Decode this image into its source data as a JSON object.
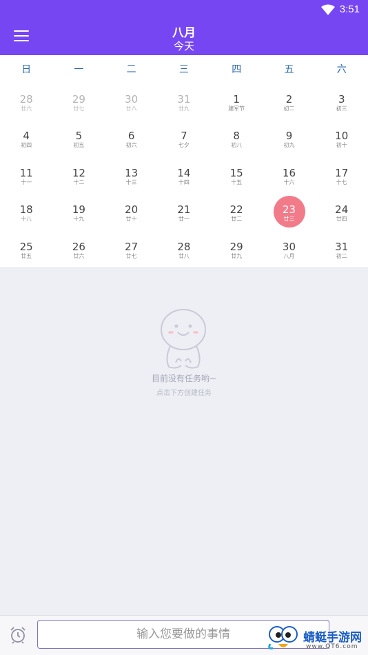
{
  "status": {
    "time": "3:51"
  },
  "header": {
    "month": "八月",
    "today_button": "今天"
  },
  "weekdays": [
    "日",
    "一",
    "二",
    "三",
    "四",
    "五",
    "六"
  ],
  "days": [
    {
      "num": "28",
      "sub": "廿六",
      "other": true
    },
    {
      "num": "29",
      "sub": "廿七",
      "other": true
    },
    {
      "num": "30",
      "sub": "廿八",
      "other": true
    },
    {
      "num": "31",
      "sub": "廿九",
      "other": true
    },
    {
      "num": "1",
      "sub": "建军节"
    },
    {
      "num": "2",
      "sub": "初二"
    },
    {
      "num": "3",
      "sub": "初三"
    },
    {
      "num": "4",
      "sub": "初四"
    },
    {
      "num": "5",
      "sub": "初五"
    },
    {
      "num": "6",
      "sub": "初六"
    },
    {
      "num": "7",
      "sub": "七夕"
    },
    {
      "num": "8",
      "sub": "初八"
    },
    {
      "num": "9",
      "sub": "初九"
    },
    {
      "num": "10",
      "sub": "初十"
    },
    {
      "num": "11",
      "sub": "十一"
    },
    {
      "num": "12",
      "sub": "十二"
    },
    {
      "num": "13",
      "sub": "十三"
    },
    {
      "num": "14",
      "sub": "十四"
    },
    {
      "num": "15",
      "sub": "十五"
    },
    {
      "num": "16",
      "sub": "十六"
    },
    {
      "num": "17",
      "sub": "十七"
    },
    {
      "num": "18",
      "sub": "十八"
    },
    {
      "num": "19",
      "sub": "十九"
    },
    {
      "num": "20",
      "sub": "廿十"
    },
    {
      "num": "21",
      "sub": "廿一"
    },
    {
      "num": "22",
      "sub": "廿二"
    },
    {
      "num": "23",
      "sub": "廿三",
      "selected": true
    },
    {
      "num": "24",
      "sub": "廿四"
    },
    {
      "num": "25",
      "sub": "廿五"
    },
    {
      "num": "26",
      "sub": "廿六"
    },
    {
      "num": "27",
      "sub": "廿七"
    },
    {
      "num": "28",
      "sub": "廿八"
    },
    {
      "num": "29",
      "sub": "廿九"
    },
    {
      "num": "30",
      "sub": "八月"
    },
    {
      "num": "31",
      "sub": "初二"
    }
  ],
  "empty": {
    "title": "目前没有任务哟~",
    "hint": "点击下方创建任务"
  },
  "input": {
    "placeholder": "输入您要做的事情"
  },
  "watermark": {
    "name": "蜻蜓手游网",
    "url": "www.QT6.com"
  },
  "colors": {
    "primary": "#7646f2",
    "selected": "#f27b8a",
    "weekday": "#2b66b0"
  },
  "icons": [
    "menu-icon",
    "wifi-icon",
    "alarm-clock-icon"
  ]
}
